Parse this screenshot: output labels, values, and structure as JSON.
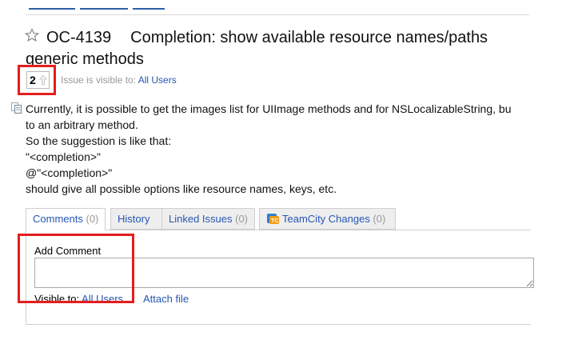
{
  "issue": {
    "key": "OC-4139",
    "title_line1": "Completion: show available resource names/paths",
    "title_line2": "generic methods",
    "votes": "2",
    "visibility_label": "Issue is visible to:",
    "visibility_value": "All Users"
  },
  "description": [
    "Currently, it is possible to get the images list for UIImage methods and for NSLocalizableString, bu",
    "to an arbitrary method.",
    "So the suggestion is like that:",
    "\"<completion>\"",
    "@\"<completion>\"",
    "should give all possible options like resource names, keys, etc."
  ],
  "tabs": [
    {
      "label": "Comments",
      "count": "(0)",
      "active": true
    },
    {
      "label": "History",
      "count": "",
      "active": false
    },
    {
      "label": "Linked Issues",
      "count": "(0)",
      "active": false
    },
    {
      "label": "TeamCity Changes",
      "count": "(0)",
      "active": false
    }
  ],
  "comment_form": {
    "label": "Add Comment",
    "value": "",
    "visible_to_label": "Visible to:",
    "visible_to_value": "All Users",
    "attach_label": "Attach file"
  },
  "colors": {
    "link": "#2456b3",
    "highlight": "#e41d1d"
  },
  "icons": [
    "star-icon",
    "vote-up-arrow-icon",
    "copy-icon",
    "teamcity-icon"
  ]
}
